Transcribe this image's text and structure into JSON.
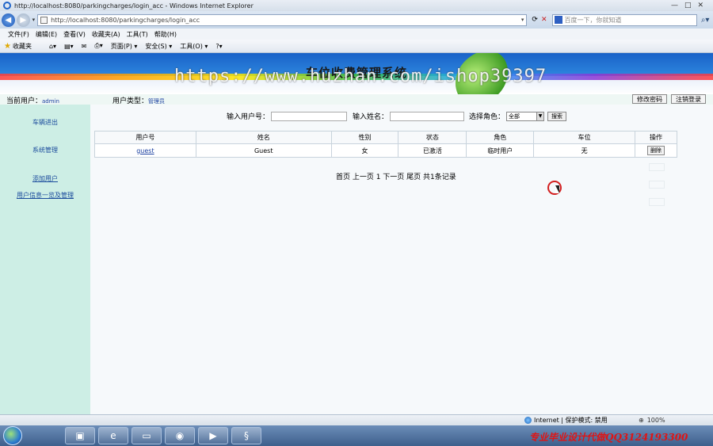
{
  "window": {
    "title": "http://localhost:8080/parkingcharges/login_acc - Windows Internet Explorer",
    "controls": [
      "—",
      "□",
      "✕"
    ]
  },
  "address": {
    "url": "http://localhost:8080/parkingcharges/login_acc",
    "search_placeholder": "百度一下，你就知道"
  },
  "menu": [
    "文件(F)",
    "编辑(E)",
    "查看(V)",
    "收藏夹(A)",
    "工具(T)",
    "帮助(H)"
  ],
  "favorites": {
    "label": "收藏夹",
    "commands": [
      "页面(P) ▾",
      "安全(S) ▾",
      "工具(O) ▾"
    ]
  },
  "header": {
    "system_title": "车位收费管理系统",
    "watermark": "https://www.huzhan.com/ishop39397",
    "current_user_label": "当前用户：",
    "current_user": "admin",
    "user_type_label": "用户类型：",
    "user_type": "管理员",
    "change_password": "修改密码",
    "logout": "注销登录"
  },
  "sidebar": {
    "items": [
      {
        "label": "车辆进出"
      },
      {
        "label": "系统管理"
      },
      {
        "label": "添加用户"
      },
      {
        "label": "用户信息一览及管理"
      }
    ]
  },
  "search": {
    "user_id_label": "输入用户号：",
    "user_id_value": "",
    "name_label": "输入姓名：",
    "name_value": "",
    "role_label": "选择角色：",
    "role_selected": "全部",
    "search_button": "搜索"
  },
  "table": {
    "columns": [
      "用户号",
      "姓名",
      "性别",
      "状态",
      "角色",
      "车位",
      "操作"
    ],
    "rows": [
      {
        "user_id": "guest",
        "name": "Guest",
        "gender": "女",
        "status": "已激活",
        "role": "临时用户",
        "spot": "无",
        "action": "删除"
      }
    ]
  },
  "pagination": {
    "text": "首页 上一页 1 下一页 尾页 共1条记录"
  },
  "statusbar": {
    "zone": "Internet | 保护模式: 禁用",
    "zoom": "100%"
  },
  "overlay": {
    "ad_text": "专业毕业设计代做QQ3124193300"
  }
}
